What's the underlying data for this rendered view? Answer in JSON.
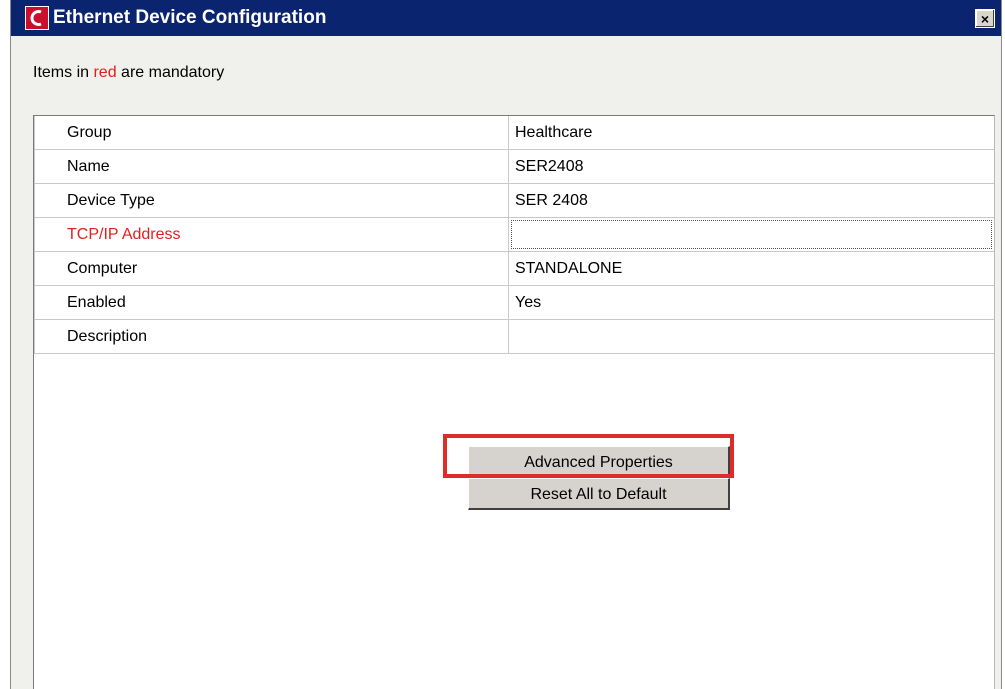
{
  "window": {
    "title": "Ethernet Device Configuration",
    "close_glyph": "×",
    "icon": "app-logo-icon"
  },
  "note": {
    "prefix": "Items in ",
    "highlight": "red",
    "suffix": " are mandatory"
  },
  "properties": [
    {
      "key": "Group",
      "value": "Healthcare",
      "required": false
    },
    {
      "key": "Name",
      "value": "SER2408",
      "required": false
    },
    {
      "key": "Device Type",
      "value": "SER 2408",
      "required": false
    },
    {
      "key": "TCP/IP Address",
      "value": "",
      "required": true
    },
    {
      "key": "Computer",
      "value": "STANDALONE",
      "required": false
    },
    {
      "key": "Enabled",
      "value": "Yes",
      "required": false
    },
    {
      "key": "Description",
      "value": "",
      "required": false
    }
  ],
  "buttons": {
    "advanced": "Advanced Properties",
    "reset": "Reset All to Default"
  },
  "colors": {
    "titlebar": "#0b2470",
    "mandatory_red": "#e0201c",
    "highlight_red": "#e02b2b",
    "button_face": "#d6d3ce"
  }
}
